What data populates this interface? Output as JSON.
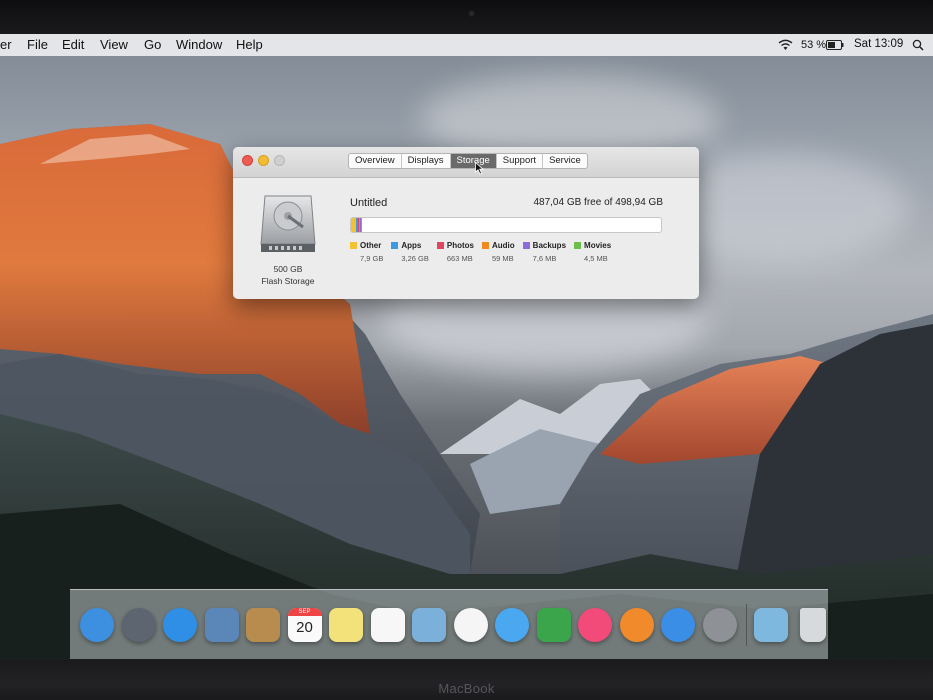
{
  "hardware": {
    "brand_label": "MacBook"
  },
  "menubar": {
    "app_name_fragment": "er",
    "items": [
      "File",
      "Edit",
      "View",
      "Go",
      "Window",
      "Help"
    ],
    "battery_percent": "53 %",
    "clock": "Sat 13:09"
  },
  "about_window": {
    "tabs": [
      {
        "label": "Overview",
        "active": false
      },
      {
        "label": "Displays",
        "active": false
      },
      {
        "label": "Storage",
        "active": true
      },
      {
        "label": "Support",
        "active": false
      },
      {
        "label": "Service",
        "active": false
      }
    ],
    "volume_name": "Untitled",
    "free_text": "487,04 GB free of 498,94 GB",
    "disk_capacity": "500 GB",
    "disk_type": "Flash Storage",
    "usage": {
      "total_gb": 498.94,
      "segments": [
        {
          "label": "Other",
          "size": "7,9 GB",
          "gb": 7.9,
          "color": "#f2c230"
        },
        {
          "label": "Apps",
          "size": "3,26 GB",
          "gb": 3.26,
          "color": "#3b9be2"
        },
        {
          "label": "Photos",
          "size": "663 MB",
          "gb": 0.663,
          "color": "#e0475e"
        },
        {
          "label": "Audio",
          "size": "59 MB",
          "gb": 0.059,
          "color": "#ef8a1f"
        },
        {
          "label": "Backups",
          "size": "7,6 MB",
          "gb": 0.0076,
          "color": "#8b6cd9"
        },
        {
          "label": "Movies",
          "size": "4,5 MB",
          "gb": 0.0045,
          "color": "#6cc04a"
        }
      ]
    }
  },
  "dock": {
    "apps": [
      {
        "name": "finder-icon",
        "color": "#3d8fe0"
      },
      {
        "name": "launchpad-icon",
        "color": "#5d6570"
      },
      {
        "name": "safari-icon",
        "color": "#2f8fe6"
      },
      {
        "name": "mail-icon",
        "color": "#5a86b8"
      },
      {
        "name": "contacts-icon",
        "color": "#b88c4e"
      },
      {
        "name": "calendar-icon",
        "color": "#f4f4f4"
      },
      {
        "name": "notes-icon",
        "color": "#f3e27a"
      },
      {
        "name": "reminders-icon",
        "color": "#f7f7f7"
      },
      {
        "name": "photo-booth-icon",
        "color": "#7ab0d9"
      },
      {
        "name": "photos-icon",
        "color": "#f5f5f5"
      },
      {
        "name": "messages-icon",
        "color": "#4aa8f0"
      },
      {
        "name": "facetime-icon",
        "color": "#3aa54a"
      },
      {
        "name": "itunes-icon",
        "color": "#f24b7a"
      },
      {
        "name": "ibooks-icon",
        "color": "#f08a2a"
      },
      {
        "name": "app-store-icon",
        "color": "#3b8ee6"
      },
      {
        "name": "system-preferences-icon",
        "color": "#8e9297"
      },
      {
        "name": "downloads-folder-icon",
        "color": "#7fb8df"
      },
      {
        "name": "trash-icon",
        "color": "#d7dadc"
      }
    ],
    "calendar_month": "SEP",
    "calendar_day": "20"
  }
}
